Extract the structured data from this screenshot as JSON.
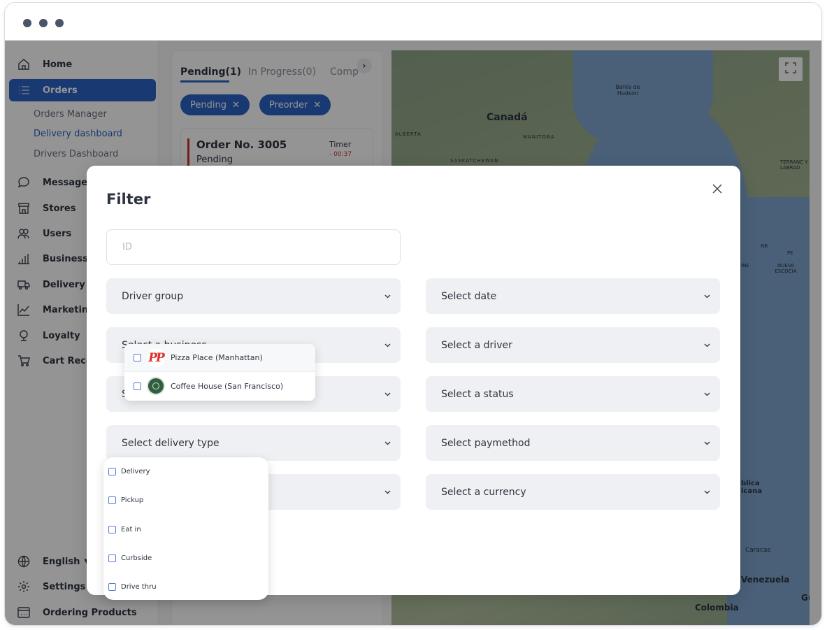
{
  "sidebar": {
    "home": "Home",
    "orders": "Orders",
    "orders_sub": [
      "Orders Manager",
      "Delivery dashboard",
      "Drivers Dashboard"
    ],
    "messages": "Messages",
    "stores": "Stores",
    "users": "Users",
    "business": "Business In",
    "delivery": "Delivery",
    "marketing": "Marketing",
    "loyalty": "Loyalty",
    "cart": "Cart Recov",
    "language": "English",
    "settings": "Settings",
    "ordering": "Ordering Products"
  },
  "orders_panel": {
    "tabs": [
      "Pending(1)",
      "In Progress(0)",
      "Comp"
    ],
    "chips": [
      "Pending",
      "Preorder"
    ],
    "card": {
      "title": "Order No. 3005",
      "status": "Pending",
      "timer_label": "Timer",
      "timer_value": "- 00:37"
    }
  },
  "map": {
    "labels": [
      "Bahía de Hudson",
      "Canadá",
      "ALBERTA",
      "MANITOBA",
      "SASKATCHEWAN",
      "TERRANC Y LABRAD",
      "NB",
      "PE",
      "NUEVA ESCOCIA",
      "INE",
      "blica icana",
      "Caracas",
      "Venezuela",
      "Colombia",
      "Gu"
    ]
  },
  "modal": {
    "title": "Filter",
    "id_placeholder": "ID",
    "left_selects": [
      "Driver group",
      "Select a business",
      "S",
      "Select delivery type",
      ""
    ],
    "right_selects": [
      "Select date",
      "Select a driver",
      "Select a status",
      "Select paymethod",
      "Select a currency"
    ]
  },
  "business_dropdown": {
    "items": [
      {
        "name": "Pizza Place (Manhattan)",
        "logo_text": "PP"
      },
      {
        "name": "Coffee House (San Francisco)",
        "logo_text": ""
      }
    ]
  },
  "delivery_dropdown": {
    "items": [
      "Delivery",
      "Pickup",
      "Eat in",
      "Curbside",
      "Drive thru"
    ]
  },
  "colors": {
    "accent": "#2b63c4",
    "overlay": "rgba(0,0,0,0.42)",
    "alert": "#d12f2f"
  }
}
